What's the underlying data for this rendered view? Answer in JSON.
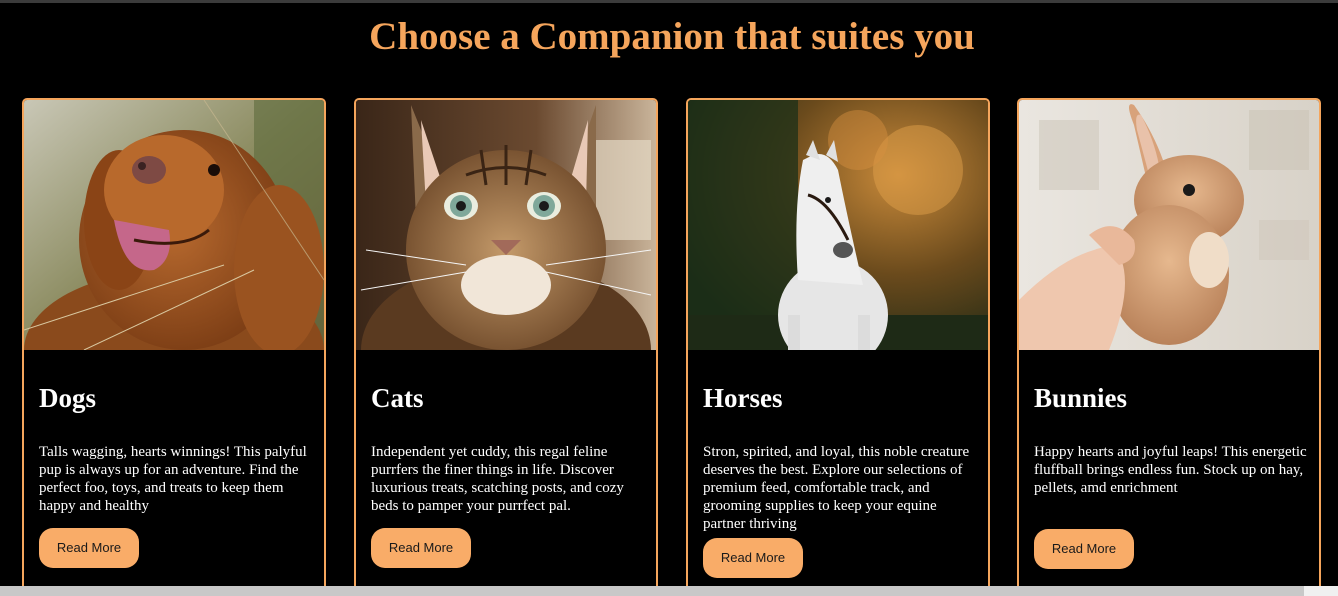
{
  "page": {
    "title": "Choose a Companion that suites you"
  },
  "colors": {
    "accent": "#f5a55c",
    "button": "#f9ac68",
    "background": "#000000",
    "text": "#ffffff"
  },
  "cards": [
    {
      "title": "Dogs",
      "text": "Talls wagging, hearts winnings! This palyful pup is always up for an adventure. Find the perfect foo, toys, and treats to keep them happy and healthy",
      "button": "Read More",
      "image": "dog-photo"
    },
    {
      "title": "Cats",
      "text": "Independent yet cuddy, this regal feline purrfers the finer things in life. Discover luxurious treats, scatching posts, and cozy beds to pamper your purrfect pal.",
      "button": "Read More",
      "image": "cat-photo"
    },
    {
      "title": "Horses",
      "text": "Stron, spirited, and loyal, this noble creature deserves the best. Explore our selections of premium feed, comfortable track, and grooming supplies to keep your equine partner thriving",
      "button": "Read More",
      "image": "horse-photo"
    },
    {
      "title": "Bunnies",
      "text": "Happy hearts and joyful leaps! This energetic fluffball brings endless fun. Stock up on hay, pellets, amd enrichment",
      "button": "Read More",
      "image": "bunny-photo"
    }
  ]
}
